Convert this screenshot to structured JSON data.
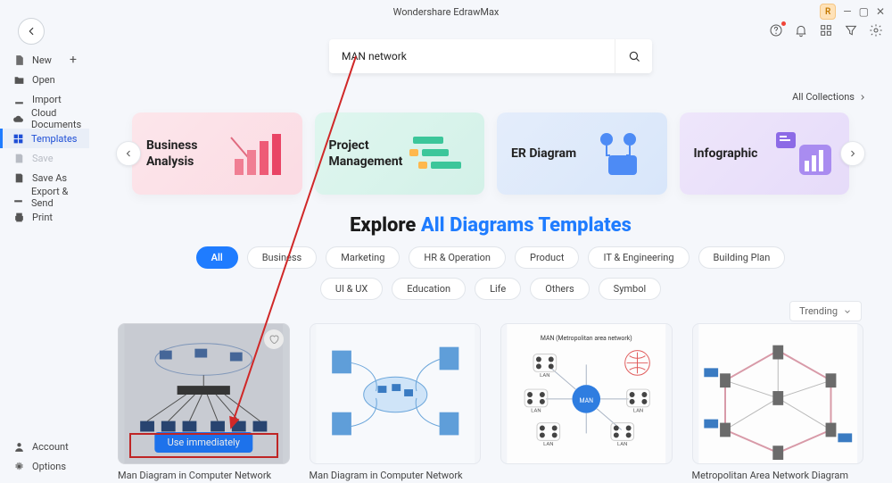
{
  "window": {
    "title": "Wondershare EdrawMax",
    "avatar_initial": "R"
  },
  "sidebar": {
    "items": [
      {
        "icon": "plus-file",
        "label": "New",
        "extra": "+"
      },
      {
        "icon": "folder",
        "label": "Open"
      },
      {
        "icon": "download",
        "label": "Import"
      },
      {
        "icon": "cloud",
        "label": "Cloud Documents"
      },
      {
        "icon": "templates",
        "label": "Templates",
        "selected": true
      },
      {
        "icon": "save",
        "label": "Save",
        "disabled": true
      },
      {
        "icon": "save-as",
        "label": "Save As"
      },
      {
        "icon": "export",
        "label": "Export & Send"
      },
      {
        "icon": "print",
        "label": "Print"
      }
    ],
    "footer": [
      {
        "icon": "user",
        "label": "Account"
      },
      {
        "icon": "gear",
        "label": "Options"
      }
    ]
  },
  "search": {
    "value": "MAN network",
    "placeholder": "Search"
  },
  "all_collections": "All Collections",
  "categories": [
    {
      "title_line1": "Business",
      "title_line2": "Analysis",
      "theme": "pink"
    },
    {
      "title_line1": "Project",
      "title_line2": "Management",
      "theme": "mint"
    },
    {
      "title_line1": "ER Diagram",
      "title_line2": "",
      "theme": "blue"
    },
    {
      "title_line1": "Infographic",
      "title_line2": "",
      "theme": "lilac"
    }
  ],
  "explore": {
    "prefix": "Explore ",
    "highlight": "All Diagrams Templates"
  },
  "filters": {
    "row1": [
      "All",
      "Business",
      "Marketing",
      "HR & Operation",
      "Product",
      "IT & Engineering",
      "Building Plan"
    ],
    "row2": [
      "UI & UX",
      "Education",
      "Life",
      "Others",
      "Symbol"
    ],
    "active": "All"
  },
  "sort": {
    "selected": "Trending"
  },
  "templates": [
    {
      "caption": "Man Diagram in Computer Network",
      "hovered": true,
      "use_label": "Use immediately"
    },
    {
      "caption": "Man Diagram in Computer Network"
    },
    {
      "caption": ""
    },
    {
      "caption": "Metropolitan Area Network Diagram"
    }
  ]
}
